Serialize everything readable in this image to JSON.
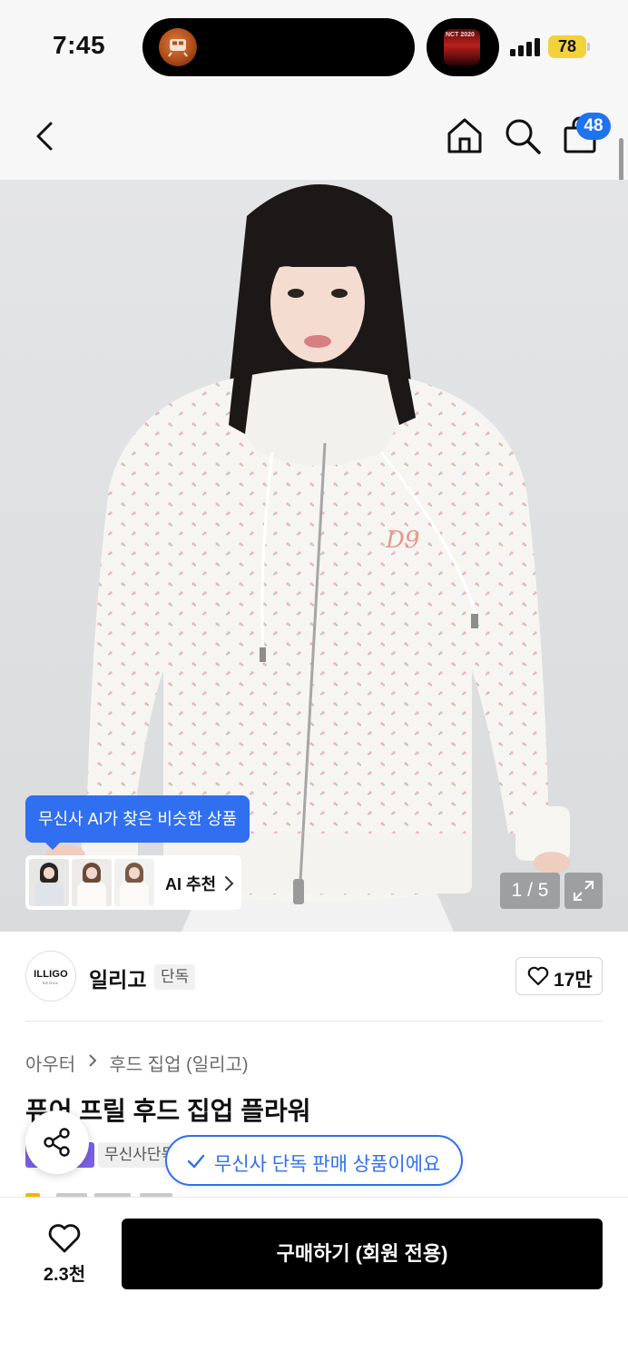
{
  "status_bar": {
    "time": "7:45",
    "live_activity_icon": "train-icon",
    "now_playing_art_text": "NCT 2020",
    "signal_bars": 4,
    "battery_level": "78"
  },
  "nav": {
    "back_icon": "chevron-left-icon",
    "home_icon": "home-icon",
    "search_icon": "search-icon",
    "cart_icon": "shopping-bag-icon",
    "cart_count": "48"
  },
  "hero": {
    "ai_tooltip": "무신사 AI가 찾은 비슷한 상품",
    "ai_recommend_label": "AI 추천",
    "image_counter": "1 / 5",
    "expand_icon": "expand-icon"
  },
  "brand": {
    "logo_text": "ILLIGO",
    "logo_subtext": "SEOUL",
    "name": "일리고",
    "tag": "단독",
    "like_count": "17만"
  },
  "product": {
    "breadcrumb": [
      "아우터",
      "후드 집업 (일리고)"
    ],
    "title": "퓨어 프릴 후드 집업 플라워",
    "benefit_tag": "무신사단독",
    "exclusive_message": "무신사 단독 판매 상품이에요"
  },
  "bottom_bar": {
    "wish_count": "2.3천",
    "buy_label": "구매하기 (회원 전용)"
  },
  "colors": {
    "accent_blue": "#2f6ff0",
    "badge_blue": "#1e73f0",
    "benefit_purple": "#7b61e8",
    "buy_button": "#000000",
    "battery_yellow": "#f2d23a"
  }
}
